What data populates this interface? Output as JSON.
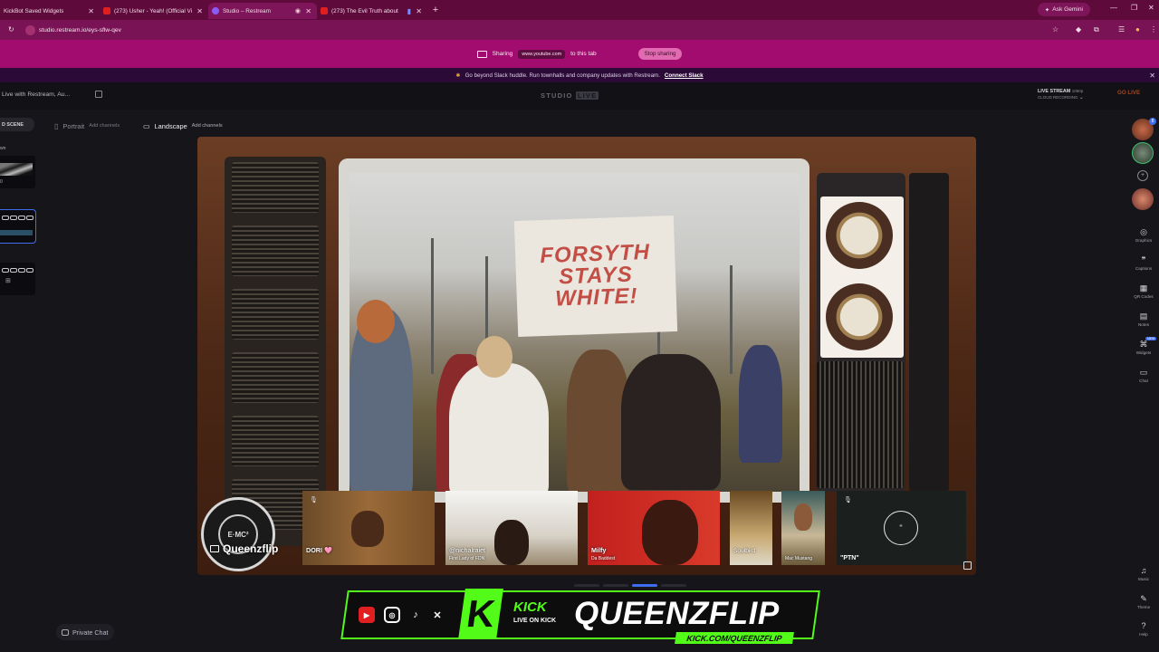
{
  "browser": {
    "tabs": [
      {
        "title": "KickBot Saved Widgets",
        "favicon_color": "#2a9df4",
        "active": false
      },
      {
        "title": "(273) Usher - Yeah! (Official Vid",
        "favicon_color": "#e02020",
        "active": false
      },
      {
        "title": "Studio – Restream",
        "favicon_color": "#8a5cf6",
        "active": true
      },
      {
        "title": "(273) The Evil Truth about I",
        "favicon_color": "#e02020",
        "active": false
      }
    ],
    "new_tab": "+",
    "gemini_label": "Ask Gemini",
    "url": "studio.restream.io/eys-sflw-qev"
  },
  "sharing": {
    "prefix": "Sharing",
    "site": "www.youtube.com",
    "suffix": "to this tab",
    "stop_label": "Stop sharing"
  },
  "banner": {
    "text": "Go beyond Slack huddle. Run townhalls and company updates with Restream.",
    "link": "Connect Slack"
  },
  "studio": {
    "project_name": "Live with Restream, Au...",
    "logo_text": "STUDIO",
    "logo_badge": "LIVE",
    "livestream_label": "LIVE STREAM",
    "livestream_res": "1080p",
    "cloud_recording": "CLOUD RECORDING",
    "go_live": "GO LIVE"
  },
  "layout": {
    "scene_button": "D SCENE",
    "portrait": "Portrait",
    "portrait_add": "Add channels",
    "landscape": "Landscape",
    "landscape_add": "Add channels"
  },
  "scenes": {
    "label_1": "wn",
    "label_2": "0"
  },
  "video": {
    "sign_line1": "FORSYTH",
    "sign_line2": "STAYS",
    "sign_line3": "WHITE!"
  },
  "participants": [
    {
      "name": "DORI 🩷",
      "sub": ""
    },
    {
      "name": "@nichalraiet",
      "sub": "First Lady of FDN"
    },
    {
      "name": "Milfy",
      "sub": "Da Baddest"
    },
    {
      "name": "Soulbird",
      "sub": ""
    },
    {
      "name": "",
      "sub": "Mac Mustang"
    },
    {
      "name": "\"PTN\"",
      "sub": ""
    }
  ],
  "host": {
    "name": "Queenzflip",
    "badge_text": "E·MC²"
  },
  "ptn_glyph": "\"",
  "rail": {
    "graphics": "Graphics",
    "captions": "Captions",
    "qr_codes": "QR Codes",
    "notes": "Notes",
    "widgets": "Widgets",
    "widgets_badge": "NEW",
    "chat": "Chat",
    "music": "Music",
    "theme": "Theme",
    "help": "Help",
    "avatar_count": "8"
  },
  "bottom": {
    "private_chat": "Private Chat"
  },
  "kick_banner": {
    "kick_word": "KICK",
    "kick_sub": "LIVE ON KICK",
    "channel": "QUEENZFLIP",
    "url": "KICK.COM/QUEENZFLIP"
  }
}
